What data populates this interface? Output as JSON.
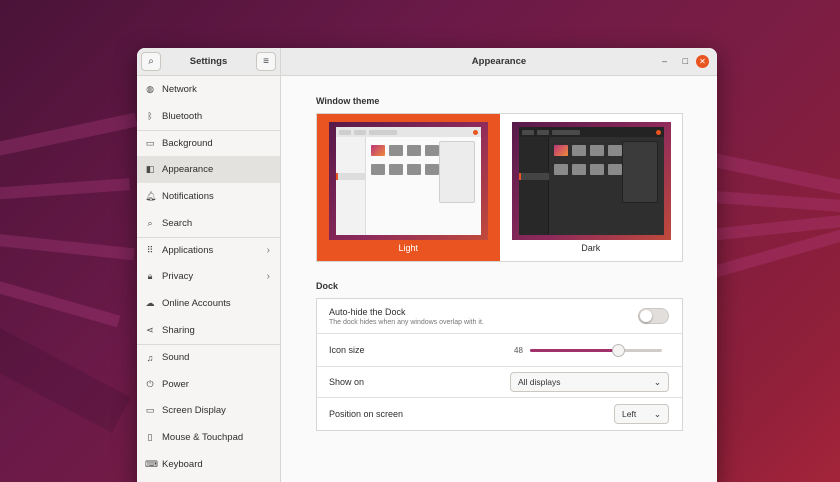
{
  "sidebar": {
    "title": "Settings",
    "search_icon": "search-icon",
    "menu_icon": "hamburger-icon",
    "items": [
      {
        "label": "Network",
        "icon": "globe-icon",
        "glyph": "◍"
      },
      {
        "label": "Bluetooth",
        "icon": "bluetooth-icon",
        "glyph": "ᛒ"
      },
      {
        "label": "Background",
        "icon": "monitor-icon",
        "glyph": "▭"
      },
      {
        "label": "Appearance",
        "icon": "appearance-icon",
        "glyph": "◧"
      },
      {
        "label": "Notifications",
        "icon": "bell-icon",
        "glyph": "🔔︎"
      },
      {
        "label": "Search",
        "icon": "search-icon",
        "glyph": "⌕"
      },
      {
        "label": "Applications",
        "icon": "grid-icon",
        "glyph": "⠿"
      },
      {
        "label": "Privacy",
        "icon": "lock-icon",
        "glyph": "🔒︎"
      },
      {
        "label": "Online Accounts",
        "icon": "cloud-icon",
        "glyph": "☁"
      },
      {
        "label": "Sharing",
        "icon": "share-icon",
        "glyph": "⋖"
      },
      {
        "label": "Sound",
        "icon": "music-icon",
        "glyph": "♫"
      },
      {
        "label": "Power",
        "icon": "power-icon",
        "glyph": "⏻"
      },
      {
        "label": "Screen Display",
        "icon": "display-icon",
        "glyph": "▭"
      },
      {
        "label": "Mouse & Touchpad",
        "icon": "mouse-icon",
        "glyph": "▯"
      },
      {
        "label": "Keyboard",
        "icon": "keyboard-icon",
        "glyph": "⌨"
      }
    ]
  },
  "header": {
    "title": "Appearance",
    "minimize_glyph": "–",
    "maximize_glyph": "□",
    "close_glyph": "✕"
  },
  "window_theme": {
    "section_title": "Window theme",
    "options": [
      {
        "label": "Light",
        "selected": true
      },
      {
        "label": "Dark",
        "selected": false
      }
    ]
  },
  "dock": {
    "section_title": "Dock",
    "autohide": {
      "title": "Auto-hide the Dock",
      "subtitle": "The dock hides when any windows overlap with it.",
      "enabled": false
    },
    "icon_size": {
      "label": "Icon size",
      "value": "48",
      "fraction": 0.67
    },
    "show_on": {
      "label": "Show on",
      "value": "All displays"
    },
    "position": {
      "label": "Position on screen",
      "value": "Left"
    }
  },
  "colors": {
    "accent": "#E95420",
    "slider_fill": "#A0316B"
  }
}
